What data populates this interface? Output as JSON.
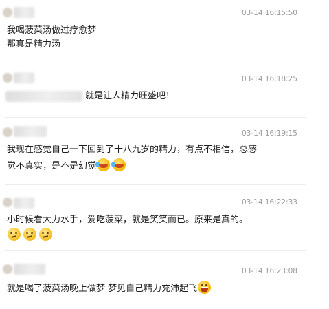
{
  "comments": [
    {
      "time": "03-14 16:15:50",
      "lines": [
        "我喝菠菜汤做过疗愈梦",
        "那真是精力汤"
      ],
      "emojis": []
    },
    {
      "time": "03-14 16:18:25",
      "lines": [
        "就是让人精力旺盛吧！"
      ],
      "emojis": []
    },
    {
      "time": "03-14 16:19:15",
      "lines": [
        "我现在感觉自己一下回到了十八九岁的精力，有点不相信，总感",
        "觉不真实，是不是幻觉"
      ],
      "emojis": [
        "crying-laughing-icon",
        "crying-laughing-icon"
      ]
    },
    {
      "time": "03-14 16:22:33",
      "lines": [
        "小时候看大力水手，爱吃菠菜，就是笑笑而已。原来是真的。"
      ],
      "emojis": [
        "thinking-face-icon",
        "thinking-face-icon",
        "thinking-face-icon"
      ]
    },
    {
      "time": "03-14 16:23:08",
      "lines": [
        "就是喝了菠菜汤晚上做梦 梦见自己精力充沛起飞"
      ],
      "emojis": [
        "grinning-face-icon"
      ]
    }
  ]
}
